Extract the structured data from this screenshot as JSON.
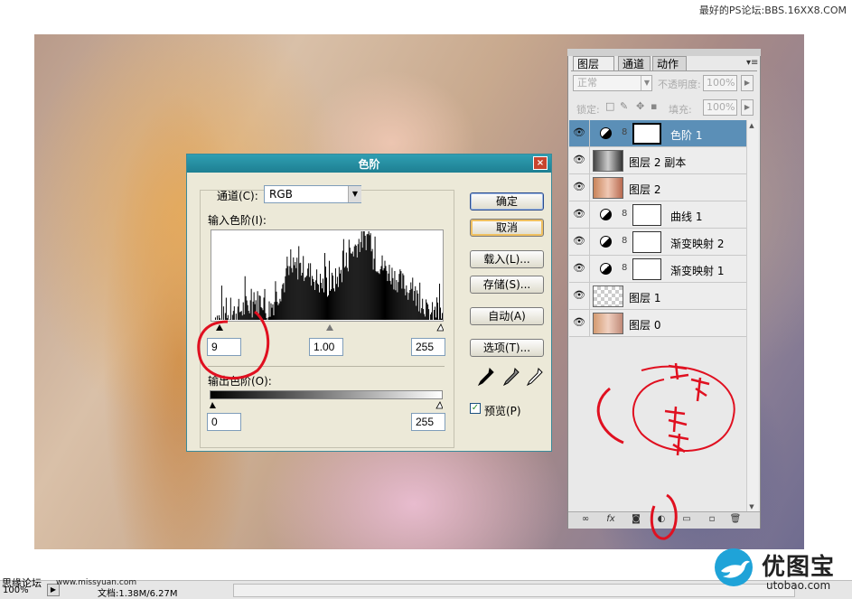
{
  "watermark_top": "最好的PS论坛:BBS.16XX8.COM",
  "status_bar": {
    "zoom": "100%",
    "forum": "思缘论坛",
    "site": "www.missyuan.com",
    "doc_info": "文档:1.38M/6.27M"
  },
  "layers_panel": {
    "tabs": [
      {
        "label": "图层",
        "active": true
      },
      {
        "label": "通道",
        "active": false
      },
      {
        "label": "动作",
        "active": false
      }
    ],
    "blend_mode": "正常",
    "opacity_label": "不透明度:",
    "opacity_value": "100%",
    "lock_label": "锁定:",
    "fill_label": "填充:",
    "fill_value": "100%",
    "layers": [
      {
        "name": "色阶 1",
        "type": "adjustment",
        "selected": true
      },
      {
        "name": "图层 2 副本",
        "type": "image",
        "selected": false
      },
      {
        "name": "图层 2",
        "type": "image",
        "selected": false
      },
      {
        "name": "曲线 1",
        "type": "adjustment",
        "selected": false
      },
      {
        "name": "渐变映射 2",
        "type": "adjustment",
        "selected": false
      },
      {
        "name": "渐变映射 1",
        "type": "adjustment",
        "selected": false
      },
      {
        "name": "图层 1",
        "type": "transparent",
        "selected": false
      },
      {
        "name": "图层 0",
        "type": "image",
        "selected": false
      }
    ],
    "bottom_buttons": [
      "link-icon",
      "fx-icon",
      "mask-icon",
      "adjustment-icon",
      "group-icon",
      "new-layer-icon",
      "trash-icon"
    ]
  },
  "levels_dialog": {
    "title": "色阶",
    "channel_label": "通道(C):",
    "channel_value": "RGB",
    "input_levels_label": "输入色阶(I):",
    "input_black": "9",
    "input_gamma": "1.00",
    "input_white": "255",
    "output_levels_label": "输出色阶(O):",
    "output_black": "0",
    "output_white": "255",
    "buttons": {
      "ok": "确定",
      "cancel": "取消",
      "load": "载入(L)...",
      "save": "存储(S)...",
      "auto": "自动(A)",
      "options": "选项(T)..."
    },
    "preview_label": "预览(P)",
    "preview_checked": true
  },
  "logo": {
    "name": "优图宝",
    "url": "utobao.com"
  },
  "colors": {
    "dialog_title": "#2f9fb2",
    "selected_layer": "#5b8fb7",
    "annotation": "#e01020"
  }
}
